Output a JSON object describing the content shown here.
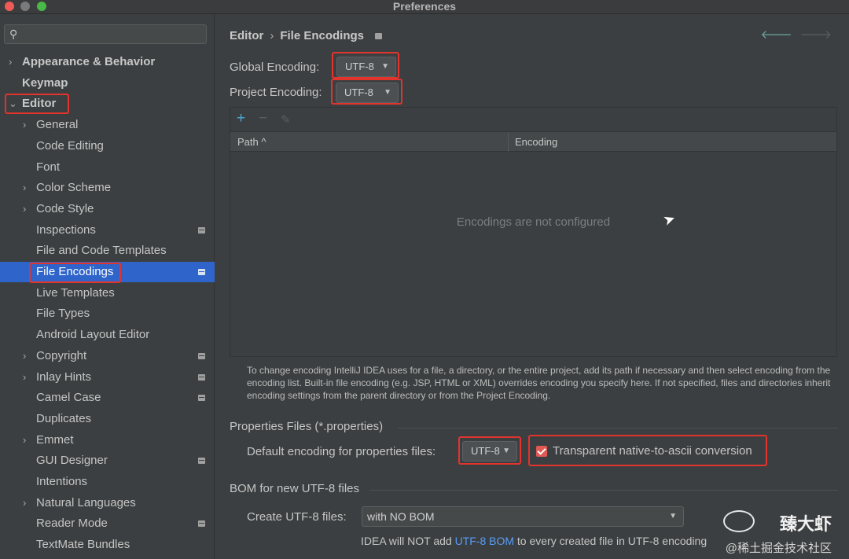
{
  "window": {
    "title": "Preferences"
  },
  "sidebar": {
    "search_placeholder": "",
    "items": [
      {
        "label": "Appearance & Behavior",
        "chevron": "›",
        "badge": false
      },
      {
        "label": "Keymap",
        "chevron": "",
        "badge": false
      },
      {
        "label": "Editor",
        "chevron": "⌄",
        "badge": false
      },
      {
        "label": "General",
        "chevron": "›",
        "badge": false
      },
      {
        "label": "Code Editing",
        "chevron": "",
        "badge": false
      },
      {
        "label": "Font",
        "chevron": "",
        "badge": false
      },
      {
        "label": "Color Scheme",
        "chevron": "›",
        "badge": false
      },
      {
        "label": "Code Style",
        "chevron": "›",
        "badge": false
      },
      {
        "label": "Inspections",
        "chevron": "",
        "badge": true
      },
      {
        "label": "File and Code Templates",
        "chevron": "",
        "badge": false
      },
      {
        "label": "File Encodings",
        "chevron": "",
        "badge": true
      },
      {
        "label": "Live Templates",
        "chevron": "",
        "badge": false
      },
      {
        "label": "File Types",
        "chevron": "",
        "badge": false
      },
      {
        "label": "Android Layout Editor",
        "chevron": "",
        "badge": false
      },
      {
        "label": "Copyright",
        "chevron": "›",
        "badge": true
      },
      {
        "label": "Inlay Hints",
        "chevron": "›",
        "badge": true
      },
      {
        "label": "Camel Case",
        "chevron": "",
        "badge": true
      },
      {
        "label": "Duplicates",
        "chevron": "",
        "badge": false
      },
      {
        "label": "Emmet",
        "chevron": "›",
        "badge": false
      },
      {
        "label": "GUI Designer",
        "chevron": "",
        "badge": true
      },
      {
        "label": "Intentions",
        "chevron": "",
        "badge": false
      },
      {
        "label": "Natural Languages",
        "chevron": "›",
        "badge": false
      },
      {
        "label": "Reader Mode",
        "chevron": "",
        "badge": true
      },
      {
        "label": "TextMate Bundles",
        "chevron": "",
        "badge": false
      }
    ]
  },
  "breadcrumb": {
    "parent": "Editor",
    "sep": "›",
    "current": "File Encodings"
  },
  "encoding": {
    "global_label": "Global Encoding:",
    "global_value": "UTF-8",
    "project_label": "Project Encoding:",
    "project_value": "UTF-8"
  },
  "table": {
    "add": "+",
    "remove": "−",
    "edit": "✎",
    "col_path": "Path",
    "col_path_sort": "^",
    "col_encoding": "Encoding",
    "empty_text": "Encodings are not configured"
  },
  "hint": "To change encoding IntelliJ IDEA uses for a file, a directory, or the entire project, add its path if necessary and then select encoding from the encoding list. Built-in file encoding (e.g. JSP, HTML or XML) overrides encoding you specify here. If not specified, files and directories inherit encoding settings from the parent directory or from the Project Encoding.",
  "properties": {
    "section_title": "Properties Files (*.properties)",
    "default_label": "Default encoding for properties files:",
    "default_value": "UTF-8",
    "transparent_label": "Transparent native-to-ascii conversion",
    "transparent_checked": true
  },
  "bom": {
    "section_title": "BOM for new UTF-8 files",
    "create_label": "Create UTF-8 files:",
    "create_value": "with NO BOM",
    "note_prefix": "IDEA will NOT add",
    "note_link": "UTF-8 BOM",
    "note_suffix": "to every created file in UTF-8 encoding"
  },
  "watermark": {
    "name": "臻大虾",
    "sub": "@稀土掘金技术社区"
  },
  "colors": {
    "selection": "#2f65ca",
    "highlight_box": "#e1342d",
    "link": "#589df6",
    "checkbox": "#e05955"
  }
}
